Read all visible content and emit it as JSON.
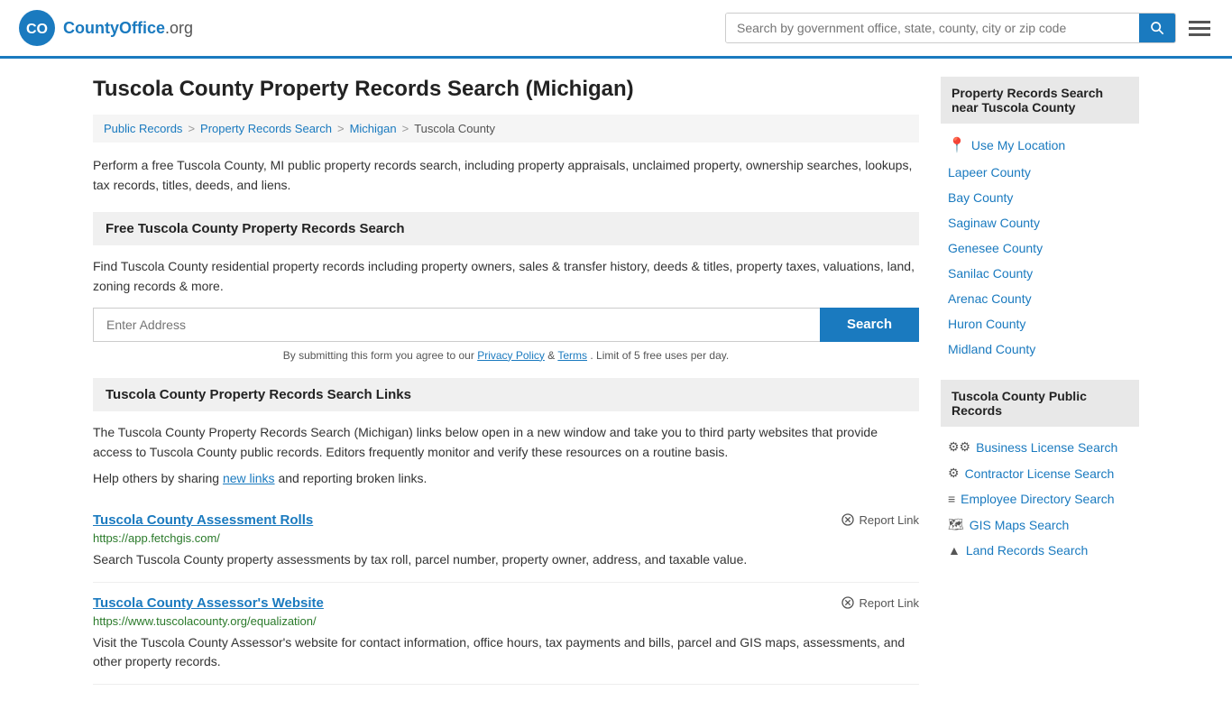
{
  "header": {
    "logo_text": "CountyOffice",
    "logo_suffix": ".org",
    "search_placeholder": "Search by government office, state, county, city or zip code",
    "search_button_label": "Search"
  },
  "page": {
    "title": "Tuscola County Property Records Search (Michigan)",
    "description": "Perform a free Tuscola County, MI public property records search, including property appraisals, unclaimed property, ownership searches, lookups, tax records, titles, deeds, and liens."
  },
  "breadcrumb": {
    "items": [
      "Public Records",
      "Property Records Search",
      "Michigan",
      "Tuscola County"
    ]
  },
  "free_search": {
    "heading": "Free Tuscola County Property Records Search",
    "description": "Find Tuscola County residential property records including property owners, sales & transfer history, deeds & titles, property taxes, valuations, land, zoning records & more.",
    "address_placeholder": "Enter Address",
    "search_label": "Search",
    "disclaimer": "By submitting this form you agree to our",
    "privacy_label": "Privacy Policy",
    "terms_label": "Terms",
    "limit_text": ". Limit of 5 free uses per day."
  },
  "links_section": {
    "heading": "Tuscola County Property Records Search Links",
    "description": "The Tuscola County Property Records Search (Michigan) links below open in a new window and take you to third party websites that provide access to Tuscola County public records. Editors frequently monitor and verify these resources on a routine basis.",
    "share_text": "Help others by sharing",
    "share_link_label": "new links",
    "share_suffix": "and reporting broken links.",
    "links": [
      {
        "title": "Tuscola County Assessment Rolls",
        "url": "https://app.fetchgis.com/",
        "description": "Search Tuscola County property assessments by tax roll, parcel number, property owner, address, and taxable value.",
        "report_label": "Report Link"
      },
      {
        "title": "Tuscola County Assessor's Website",
        "url": "https://www.tuscolacounty.org/equalization/",
        "description": "Visit the Tuscola County Assessor's website for contact information, office hours, tax payments and bills, parcel and GIS maps, assessments, and other property records.",
        "report_label": "Report Link"
      }
    ]
  },
  "sidebar": {
    "nearby_title": "Property Records Search near Tuscola County",
    "use_my_location": "Use My Location",
    "nearby_counties": [
      "Lapeer County",
      "Bay County",
      "Saginaw County",
      "Genesee County",
      "Sanilac County",
      "Arenac County",
      "Huron County",
      "Midland County"
    ],
    "public_records_title": "Tuscola County Public Records",
    "public_records_links": [
      {
        "icon": "⚙",
        "label": "Business License Search"
      },
      {
        "icon": "⚙",
        "label": "Contractor License Search"
      },
      {
        "icon": "≡",
        "label": "Employee Directory Search"
      },
      {
        "icon": "🗺",
        "label": "GIS Maps Search"
      },
      {
        "icon": "▲",
        "label": "Land Records Search"
      }
    ]
  }
}
